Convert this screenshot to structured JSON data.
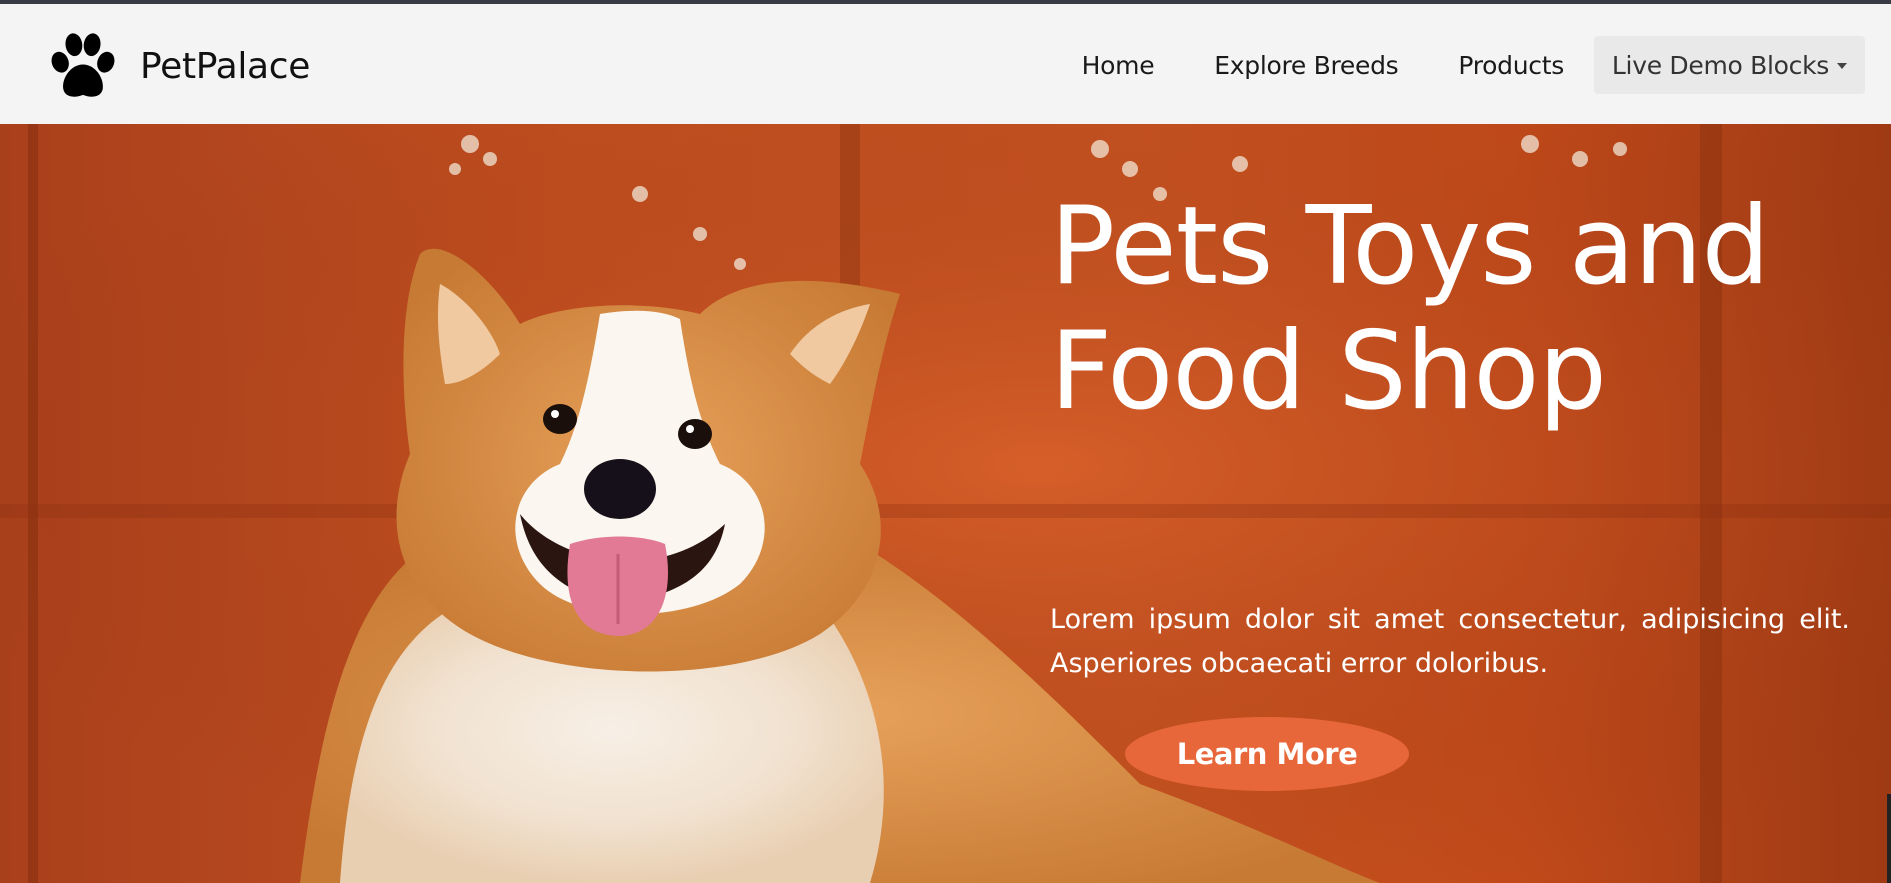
{
  "brand": {
    "name": "PetPalace",
    "logo_icon": "paw-icon"
  },
  "nav": {
    "items": [
      {
        "label": "Home"
      },
      {
        "label": "Explore Breeds"
      },
      {
        "label": "Products"
      },
      {
        "label": "Live Demo Blocks",
        "has_dropdown": true
      }
    ]
  },
  "hero": {
    "title": "Pets Toys and Food Shop",
    "description": "Lorem ipsum dolor sit amet consectetur, adipisicing elit. Asperiores obcaecati error doloribus.",
    "cta_label": "Learn More",
    "image_subject": "smiling corgi dog in front of an orange wall"
  },
  "colors": {
    "nav_bg": "#f4f4f4",
    "hero_bg": "#c14f20",
    "cta_bg": "#e8673a",
    "text_light": "#ffffff"
  }
}
